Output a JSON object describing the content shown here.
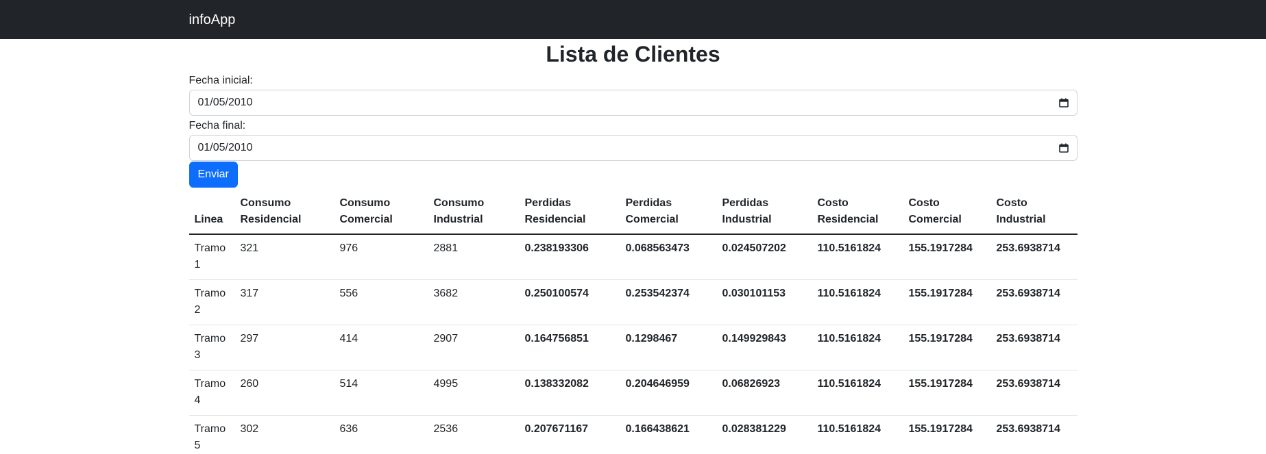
{
  "navbar": {
    "brand": "infoApp"
  },
  "page": {
    "title": "Lista de Clientes"
  },
  "form": {
    "start_label": "Fecha inicial:",
    "start_value": "01/05/2010",
    "end_label": "Fecha final:",
    "end_value": "01/05/2010",
    "submit_label": "Enviar"
  },
  "table": {
    "headers": [
      "Linea",
      "Consumo Residencial",
      "Consumo Comercial",
      "Consumo Industrial",
      "Perdidas Residencial",
      "Perdidas Comercial",
      "Perdidas Industrial",
      "Costo Residencial",
      "Costo Comercial",
      "Costo Industrial"
    ],
    "rows": [
      [
        "Tramo 1",
        "321",
        "976",
        "2881",
        "0.238193306",
        "0.068563473",
        "0.024507202",
        "110.5161824",
        "155.1917284",
        "253.6938714"
      ],
      [
        "Tramo 2",
        "317",
        "556",
        "3682",
        "0.250100574",
        "0.253542374",
        "0.030101153",
        "110.5161824",
        "155.1917284",
        "253.6938714"
      ],
      [
        "Tramo 3",
        "297",
        "414",
        "2907",
        "0.164756851",
        "0.1298467",
        "0.149929843",
        "110.5161824",
        "155.1917284",
        "253.6938714"
      ],
      [
        "Tramo 4",
        "260",
        "514",
        "4995",
        "0.138332082",
        "0.204646959",
        "0.06826923",
        "110.5161824",
        "155.1917284",
        "253.6938714"
      ],
      [
        "Tramo 5",
        "302",
        "636",
        "2536",
        "0.207671167",
        "0.166438621",
        "0.028381229",
        "110.5161824",
        "155.1917284",
        "253.6938714"
      ]
    ]
  },
  "colors": {
    "navbar_bg": "#212529",
    "primary": "#0d6efd",
    "text": "#212529"
  },
  "icons": {
    "date_picker": "calendar-icon"
  }
}
